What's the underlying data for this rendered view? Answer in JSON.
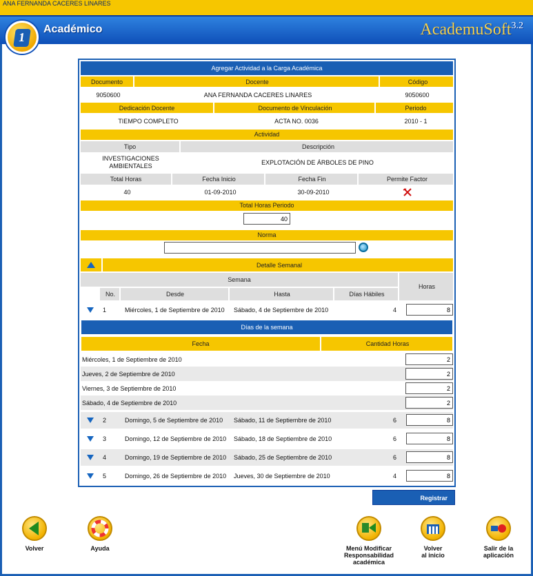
{
  "user_name": "ANA FERNANDA CACERES LINARES",
  "header": {
    "title": "Académico",
    "brand": "AcademuSoft",
    "version": "3.2"
  },
  "form": {
    "title": "Agregar Actividad a la Carga Académica",
    "labels": {
      "documento": "Documento",
      "docente": "Docente",
      "codigo": "Código",
      "dedicacion": "Dedicación Docente",
      "doc_vinculacion": "Documento de Vinculación",
      "periodo": "Periodo",
      "actividad": "Actividad",
      "tipo": "Tipo",
      "descripcion": "Descripción",
      "total_horas": "Total Horas",
      "fecha_inicio": "Fecha Inicio",
      "fecha_fin": "Fecha Fin",
      "permite_factor": "Permite Factor",
      "total_horas_periodo": "Total Horas Periodo",
      "norma": "Norma",
      "detalle_semanal": "Detalle Semanal",
      "semana": "Semana",
      "horas": "Horas",
      "no": "No.",
      "desde": "Desde",
      "hasta": "Hasta",
      "dias_habiles": "Días Hábiles",
      "dias_semana": "Días de la semana",
      "fecha": "Fecha",
      "cantidad_horas": "Cantidad Horas"
    },
    "values": {
      "documento": "9050600",
      "docente": "ANA FERNANDA CACERES LINARES",
      "codigo": "9050600",
      "dedicacion": "TIEMPO COMPLETO",
      "doc_vinculacion": "ACTA NO. 0036",
      "periodo": "2010 - 1",
      "tipo_line1": "INVESTIGACIONES",
      "tipo_line2": "AMBIENTALES",
      "descripcion": "EXPLOTACIÓN DE ÁRBOLES DE PINO",
      "total_horas": "40",
      "fecha_inicio": "01-09-2010",
      "fecha_fin": "30-09-2010",
      "total_horas_periodo": "40",
      "norma": ""
    },
    "week1": {
      "no": "1",
      "desde": "Miércoles, 1 de Septiembre de 2010",
      "hasta": "Sábado, 4 de Septiembre de 2010",
      "dias": "4",
      "horas": "8"
    },
    "days": [
      {
        "fecha": "Miércoles, 1 de Septiembre de 2010",
        "horas": "2"
      },
      {
        "fecha": "Jueves, 2 de Septiembre de 2010",
        "horas": "2"
      },
      {
        "fecha": "Viernes, 3 de Septiembre de 2010",
        "horas": "2"
      },
      {
        "fecha": "Sábado, 4 de Septiembre de 2010",
        "horas": "2"
      }
    ],
    "weeks": [
      {
        "no": "2",
        "desde": "Domingo, 5 de Septiembre de 2010",
        "hasta": "Sábado, 11 de Septiembre de 2010",
        "dias": "6",
        "horas": "8"
      },
      {
        "no": "3",
        "desde": "Domingo, 12 de Septiembre de 2010",
        "hasta": "Sábado, 18 de Septiembre de 2010",
        "dias": "6",
        "horas": "8"
      },
      {
        "no": "4",
        "desde": "Domingo, 19 de Septiembre de 2010",
        "hasta": "Sábado, 25 de Septiembre de 2010",
        "dias": "6",
        "horas": "8"
      },
      {
        "no": "5",
        "desde": "Domingo, 26 de Septiembre de 2010",
        "hasta": "Jueves, 30 de Septiembre de 2010",
        "dias": "4",
        "horas": "8"
      }
    ],
    "register": "Registrar"
  },
  "nav": {
    "volver": "Volver",
    "ayuda": "Ayuda",
    "menu_l1": "Menú Modificar",
    "menu_l2": "Responsabilidad",
    "menu_l3": "académica",
    "inicio_l1": "Volver",
    "inicio_l2": "al inicio",
    "salir_l1": "Salir de la",
    "salir_l2": "aplicación"
  },
  "colors": {
    "blue": "#1a5fb4",
    "yellow": "#f6c600"
  }
}
